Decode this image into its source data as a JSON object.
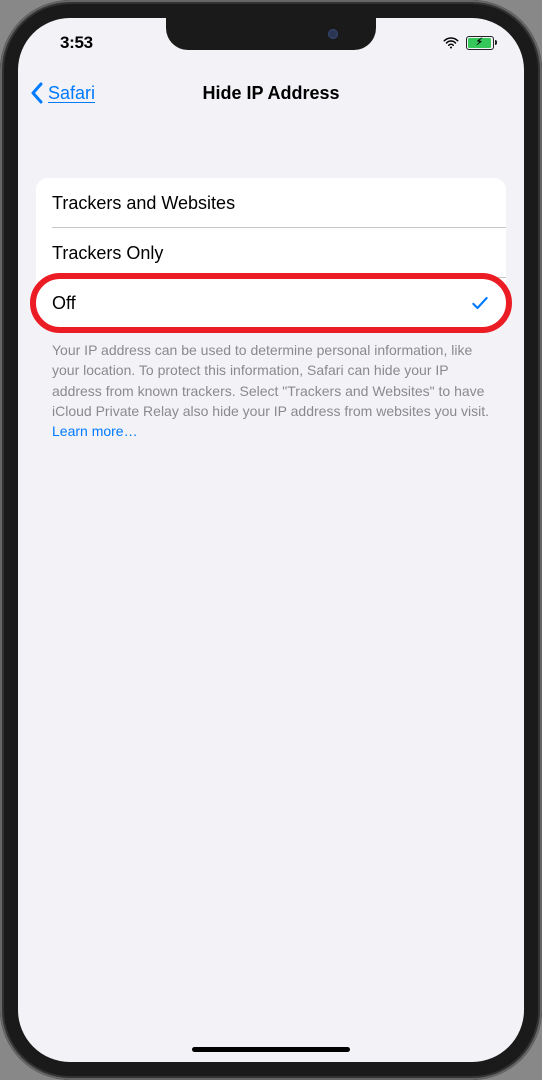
{
  "status": {
    "time": "3:53"
  },
  "nav": {
    "back_label": "Safari",
    "title": "Hide IP Address"
  },
  "options": [
    {
      "label": "Trackers and Websites",
      "selected": false,
      "highlighted": false
    },
    {
      "label": "Trackers Only",
      "selected": false,
      "highlighted": false
    },
    {
      "label": "Off",
      "selected": true,
      "highlighted": true
    }
  ],
  "footer": {
    "text": "Your IP address can be used to determine personal information, like your location. To protect this information, Safari can hide your IP address from known trackers. Select \"Trackers and Websites\" to have iCloud Private Relay also hide your IP address from websites you visit. ",
    "learn_more_label": "Learn more…"
  }
}
